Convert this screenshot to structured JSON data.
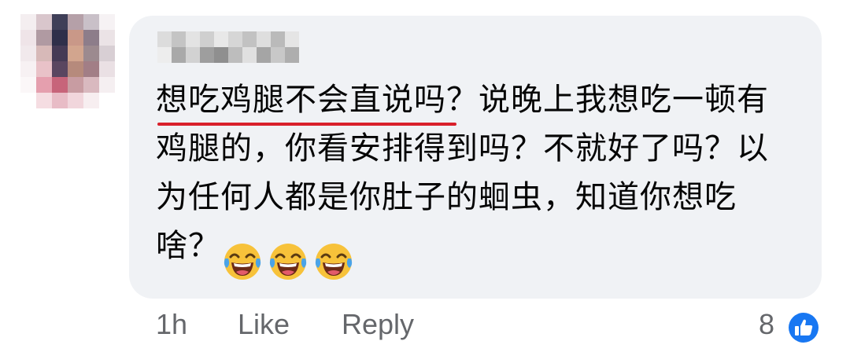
{
  "comment": {
    "lines": [
      "想吃鸡腿不会直说吗？说晚上我想吃一顿有",
      "鸡腿的，你看安排得到吗？不就好了吗？以",
      "为任何人都是你肚子的蛔虫，知道你想吃",
      "啥？"
    ],
    "emojis": [
      "laughing-crying-emoji",
      "laughing-crying-emoji",
      "laughing-crying-emoji"
    ],
    "underline_color": "#d9202b"
  },
  "actions": {
    "time": "1h",
    "like_label": "Like",
    "reply_label": "Reply"
  },
  "reactions": {
    "count": "8",
    "icon": "thumbs-up-icon",
    "badge_color": "#1877f2"
  }
}
